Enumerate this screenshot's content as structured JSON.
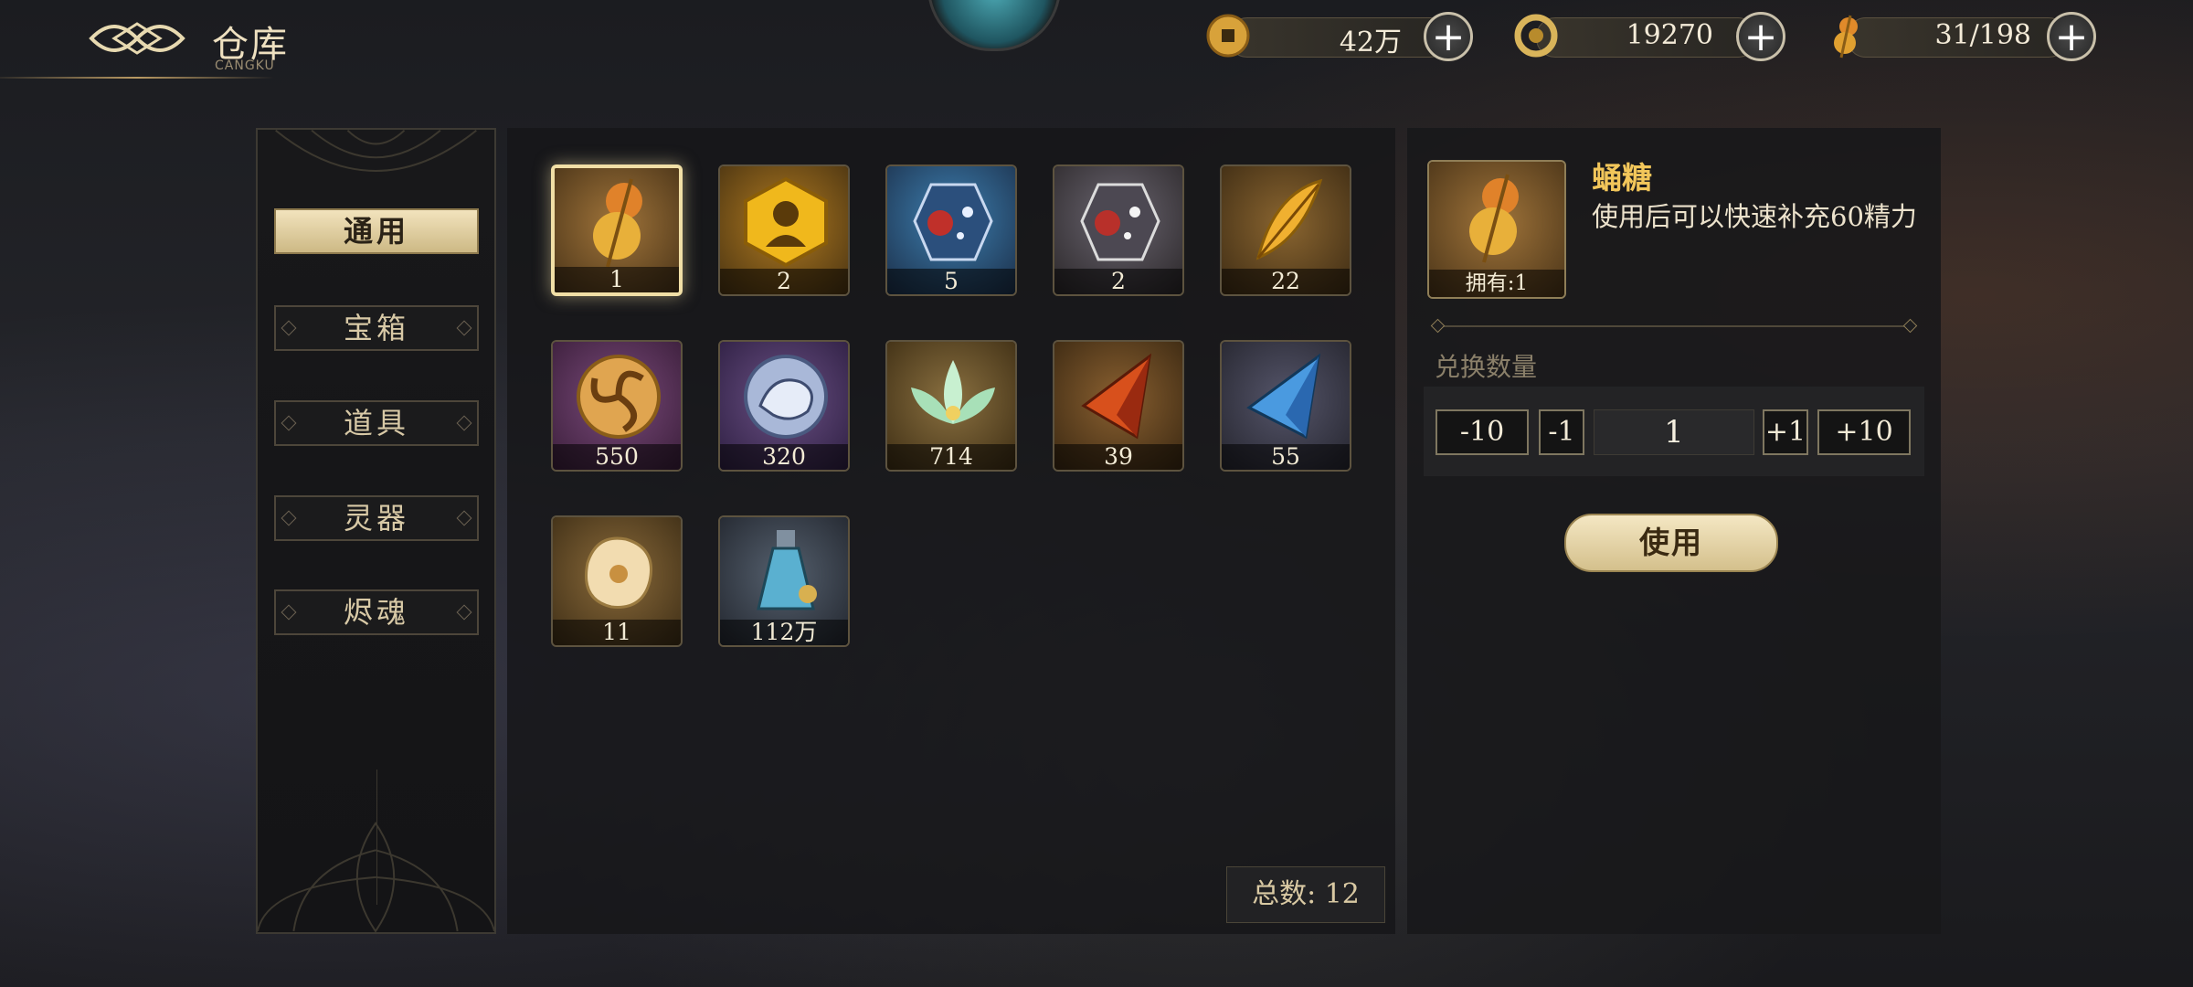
{
  "header": {
    "title": "仓库",
    "subtitle": "CANGKU"
  },
  "currencies": [
    {
      "icon": "copper-coin-icon",
      "value": "42万",
      "plus": "+"
    },
    {
      "icon": "jade-dragon-icon",
      "value": "19270",
      "plus": "+"
    },
    {
      "icon": "candied-gourd-icon",
      "value": "31/198",
      "plus": "+"
    }
  ],
  "tabs": [
    {
      "label": "通用",
      "active": true
    },
    {
      "label": "宝箱",
      "active": false
    },
    {
      "label": "道具",
      "active": false
    },
    {
      "label": "灵器",
      "active": false
    },
    {
      "label": "烬魂",
      "active": false
    }
  ],
  "items": [
    {
      "icon": "candied-gourd-icon",
      "count": "1",
      "color": "#6b4a1e",
      "selected": true
    },
    {
      "icon": "gold-hexagon-silhouette-icon",
      "count": "2",
      "color": "#7a5a14"
    },
    {
      "icon": "blue-red-crystal-icon",
      "count": "5",
      "color": "#1f4d73"
    },
    {
      "icon": "grey-red-crystal-icon",
      "count": "2",
      "color": "#4a4448"
    },
    {
      "icon": "golden-feather-icon",
      "count": "22",
      "color": "#6a4c1e"
    },
    {
      "icon": "triskelion-medallion-icon",
      "count": "550",
      "color": "#4a2a4c"
    },
    {
      "icon": "tiger-medallion-icon",
      "count": "320",
      "color": "#3d2d52"
    },
    {
      "icon": "jade-lotus-icon",
      "count": "714",
      "color": "#5c4a22"
    },
    {
      "icon": "red-pyramid-shard-icon",
      "count": "39",
      "color": "#5b3e1c"
    },
    {
      "icon": "blue-pyramid-shard-icon",
      "count": "55",
      "color": "#3d3d48"
    },
    {
      "icon": "amber-stone-icon",
      "count": "11",
      "color": "#5b4422"
    },
    {
      "icon": "potion-bottle-icon",
      "count": "112万",
      "color": "#3a3f4a"
    }
  ],
  "total": "总数: 12",
  "detail": {
    "name": "蛹糖",
    "description": "使用后可以快速补充60精力",
    "owned": "拥有:1",
    "quantity_label": "兑换数量",
    "quantity": "1",
    "minus10": "-10",
    "minus1": "-1",
    "plus1": "+1",
    "plus10": "+10",
    "use_label": "使用"
  }
}
